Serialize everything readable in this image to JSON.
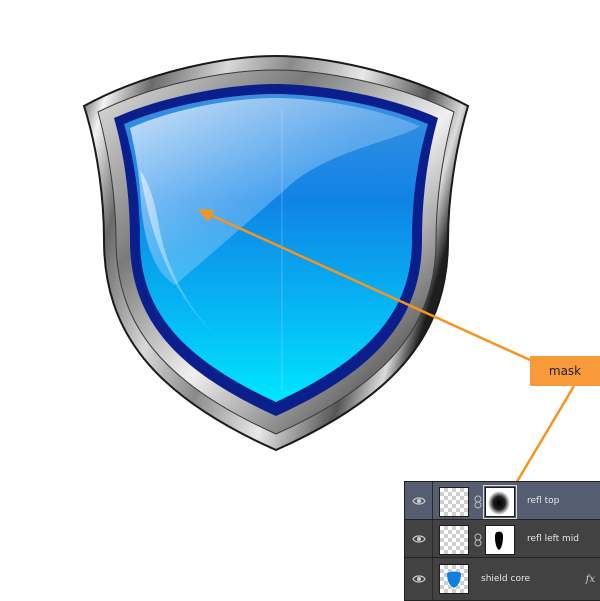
{
  "canvas": {
    "artwork": "glossy-blue-shield-with-chrome-rim",
    "colors": {
      "shield_top": "#4aa8f0",
      "shield_mid": "#0f8fe8",
      "shield_bottom": "#00e0ff",
      "inner_border": "#0a1f8c",
      "rim_light": "#f2f2f2",
      "rim_dark": "#202020",
      "annotation": "#f7941d"
    }
  },
  "annotation": {
    "callout_label": "mask",
    "callout_color": "#f99a3a"
  },
  "layers_panel": {
    "layers": [
      {
        "name": "refl top",
        "visible": true,
        "selected": true,
        "has_mask": true,
        "mask_icon": "soft-black-blob-mask",
        "icon": "eye-icon"
      },
      {
        "name": "refl left mid",
        "visible": true,
        "selected": false,
        "has_mask": true,
        "mask_icon": "black-shape-mask",
        "icon": "eye-icon"
      },
      {
        "name": "shield core",
        "visible": true,
        "selected": false,
        "has_mask": false,
        "thumb_icon": "blue-shield-thumbnail",
        "icon": "eye-icon",
        "effects_label": "fx"
      }
    ]
  }
}
